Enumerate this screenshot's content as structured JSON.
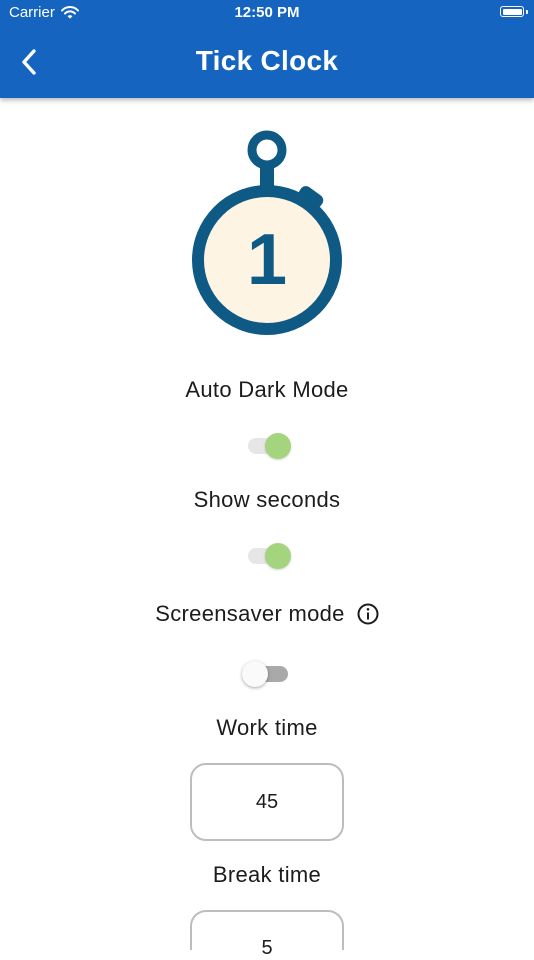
{
  "status_bar": {
    "carrier": "Carrier",
    "time": "12:50 PM",
    "wifi_icon": "wifi-icon",
    "battery_icon": "battery-icon"
  },
  "header": {
    "title": "Tick Clock",
    "back_icon": "chevron-left-icon",
    "background_color": "#1565c0"
  },
  "logo": {
    "digit": "1",
    "ring_color": "#0f5a85",
    "face_color": "#fdf4e3"
  },
  "settings": {
    "auto_dark_mode": {
      "label": "Auto Dark Mode",
      "enabled": true
    },
    "show_seconds": {
      "label": "Show seconds",
      "enabled": true
    },
    "screensaver_mode": {
      "label": "Screensaver mode",
      "enabled": false,
      "info_icon": "info-icon"
    },
    "work_time": {
      "label": "Work time",
      "value": "45"
    },
    "break_time": {
      "label": "Break time",
      "value": "5"
    }
  },
  "colors": {
    "toggle_on": "#a5d47e",
    "toggle_off_track": "#a9a9a9"
  }
}
